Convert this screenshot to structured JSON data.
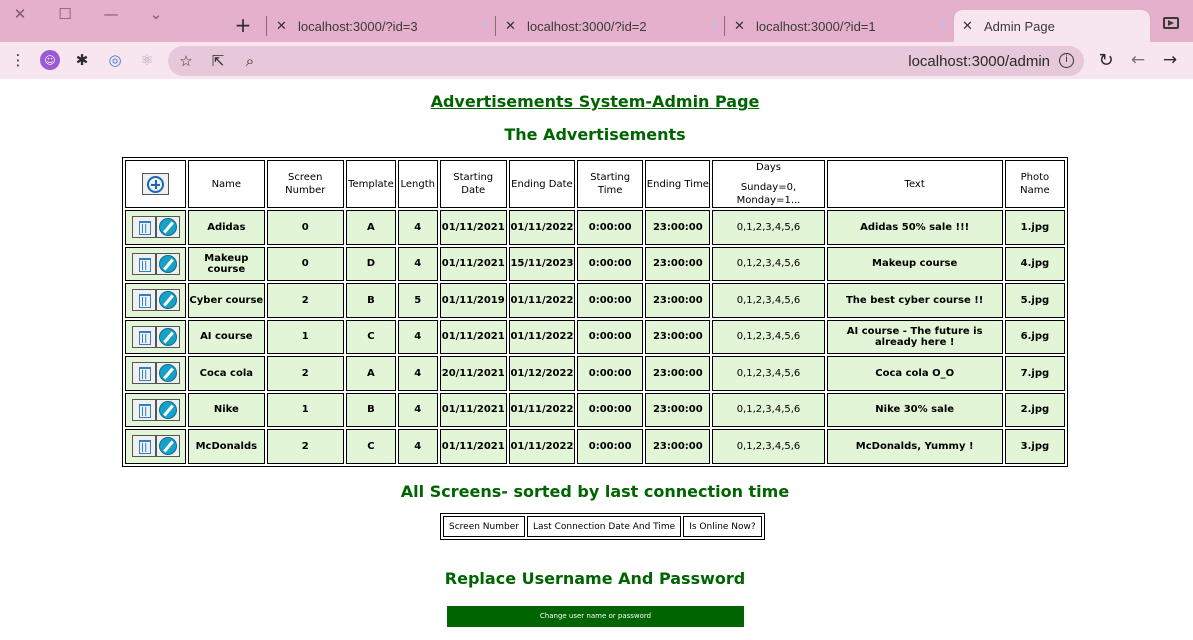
{
  "browser": {
    "tabs": [
      {
        "title": "localhost:3000/?id=3"
      },
      {
        "title": "localhost:3000/?id=2"
      },
      {
        "title": "localhost:3000/?id=1"
      },
      {
        "title": "Admin Page"
      }
    ],
    "url": "localhost:3000/admin"
  },
  "page": {
    "title": "Advertisements System-Admin Page",
    "ads_heading": "The Advertisements",
    "screens_heading": "All Screens- sorted by last connection time",
    "replace_heading": "Replace Username And Password",
    "change_button": "Change user name or password"
  },
  "ads_table": {
    "headers": {
      "name": "Name",
      "screen": "Screen Number",
      "template": "Template",
      "length": "Length",
      "start_date": "Starting Date",
      "end_date": "Ending Date",
      "start_time": "Starting Time",
      "end_time": "Ending Time",
      "days": "Days",
      "days_sub": "Sunday=0, Monday=1...",
      "text": "Text",
      "photo": "Photo Name"
    },
    "rows": [
      {
        "name": "Adidas",
        "screen": "0",
        "template": "A",
        "length": "4",
        "start_date": "01/11/2021",
        "end_date": "01/11/2022",
        "start_time": "0:00:00",
        "end_time": "23:00:00",
        "days": "0,1,2,3,4,5,6",
        "text": "Adidas 50% sale !!!",
        "photo": "1.jpg"
      },
      {
        "name": "Makeup course",
        "screen": "0",
        "template": "D",
        "length": "4",
        "start_date": "01/11/2021",
        "end_date": "15/11/2023",
        "start_time": "0:00:00",
        "end_time": "23:00:00",
        "days": "0,1,2,3,4,5,6",
        "text": "Makeup course",
        "photo": "4.jpg"
      },
      {
        "name": "Cyber course",
        "screen": "2",
        "template": "B",
        "length": "5",
        "start_date": "01/11/2019",
        "end_date": "01/11/2022",
        "start_time": "0:00:00",
        "end_time": "23:00:00",
        "days": "0,1,2,3,4,5,6",
        "text": "The best cyber course !!",
        "photo": "5.jpg"
      },
      {
        "name": "AI course",
        "screen": "1",
        "template": "C",
        "length": "4",
        "start_date": "01/11/2021",
        "end_date": "01/11/2022",
        "start_time": "0:00:00",
        "end_time": "23:00:00",
        "days": "0,1,2,3,4,5,6",
        "text": "AI course - The future is already here !",
        "photo": "6.jpg"
      },
      {
        "name": "Coca cola",
        "screen": "2",
        "template": "A",
        "length": "4",
        "start_date": "20/11/2021",
        "end_date": "01/12/2022",
        "start_time": "0:00:00",
        "end_time": "23:00:00",
        "days": "0,1,2,3,4,5,6",
        "text": "Coca cola O_O",
        "photo": "7.jpg"
      },
      {
        "name": "Nike",
        "screen": "1",
        "template": "B",
        "length": "4",
        "start_date": "01/11/2021",
        "end_date": "01/11/2022",
        "start_time": "0:00:00",
        "end_time": "23:00:00",
        "days": "0,1,2,3,4,5,6",
        "text": "Nike 30% sale",
        "photo": "2.jpg"
      },
      {
        "name": "McDonalds",
        "screen": "2",
        "template": "C",
        "length": "4",
        "start_date": "01/11/2021",
        "end_date": "01/11/2022",
        "start_time": "0:00:00",
        "end_time": "23:00:00",
        "days": "0,1,2,3,4,5,6",
        "text": "McDonalds, Yummy !",
        "photo": "3.jpg"
      }
    ]
  },
  "screens_table": {
    "headers": [
      "Screen Number",
      "Last Connection Date And Time",
      "Is Online Now?"
    ]
  },
  "colors": {
    "heading_green": "#006400",
    "row_bg": "#e2f5d6",
    "tabbar": "#e4b0cb",
    "toolbar": "#f7e6f0"
  }
}
